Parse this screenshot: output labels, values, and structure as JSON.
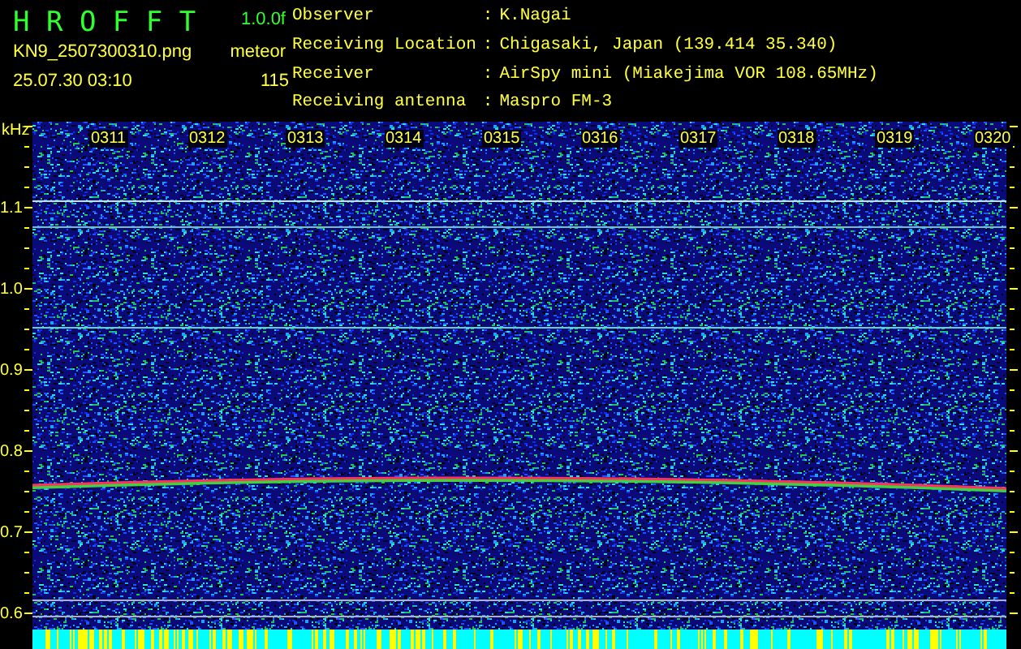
{
  "header": {
    "app_name": "H R O F F T",
    "version": "1.0.0f",
    "file_name": "KN9_2507300310.png",
    "timestamp": "25.07.30 03:10",
    "meteor_label": "meteor",
    "meteor_count": "115"
  },
  "station_info": [
    {
      "label": "Observer",
      "separator": ":",
      "value": "K.Nagai"
    },
    {
      "label": "Receiving Location",
      "separator": ":",
      "value": "Chigasaki, Japan (139.414 35.340)"
    },
    {
      "label": "Receiver",
      "separator": ":",
      "value": "AirSpy mini (Miakejima VOR 108.65MHz)"
    },
    {
      "label": "Receiving antenna",
      "separator": ":",
      "value": "Maspro FM-3"
    }
  ],
  "spectrogram": {
    "unit": "kHz",
    "frequency_labels": [
      "1.1",
      "1.0",
      "0.9",
      "0.8",
      "0.7",
      "0.6"
    ],
    "time_labels": [
      "0311",
      "0312",
      "0313",
      "0314",
      "0315",
      "0316",
      "0317",
      "0318",
      "0319",
      "0320"
    ]
  }
}
